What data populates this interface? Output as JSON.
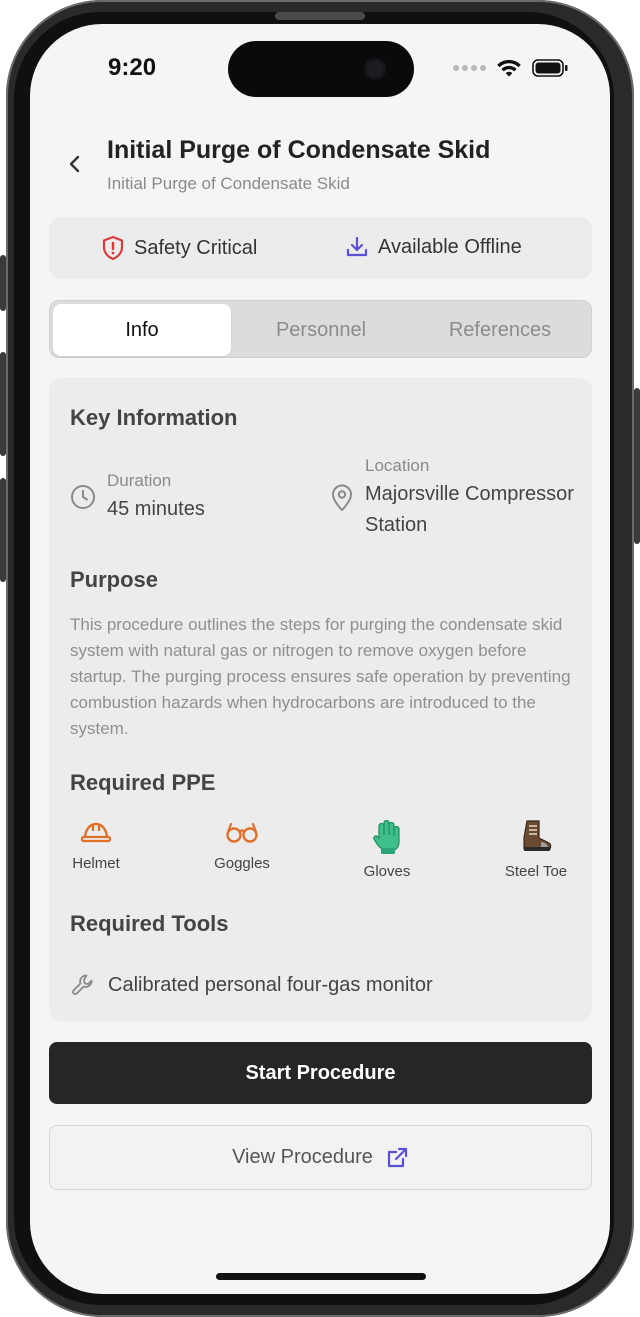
{
  "status_bar": {
    "time": "9:20"
  },
  "header": {
    "title": "Initial Purge of Condensate Skid",
    "subtitle": "Initial Purge of Condensate Skid"
  },
  "badges": {
    "safety": "Safety Critical",
    "offline": "Available Offline"
  },
  "tabs": [
    {
      "label": "Info",
      "active": true
    },
    {
      "label": "Personnel",
      "active": false
    },
    {
      "label": "References",
      "active": false
    }
  ],
  "key_info": {
    "title": "Key Information",
    "duration_label": "Duration",
    "duration_value": "45 minutes",
    "location_label": "Location",
    "location_line1": "Majorsville Compressor",
    "location_line2": "Station"
  },
  "purpose": {
    "title": "Purpose",
    "text": "This procedure outlines the steps for purging the condensate skid system with natural gas or nitrogen to remove oxygen before startup. The purging process ensures safe operation by preventing combustion hazards when hydrocarbons are introduced to the system."
  },
  "ppe": {
    "title": "Required PPE",
    "items": [
      {
        "label": "Helmet",
        "icon": "helmet-icon"
      },
      {
        "label": "Goggles",
        "icon": "goggles-icon"
      },
      {
        "label": "Gloves",
        "icon": "gloves-icon"
      },
      {
        "label": "Steel Toe",
        "icon": "boot-icon"
      }
    ]
  },
  "tools": {
    "title": "Required Tools",
    "items": [
      {
        "label": "Calibrated personal four-gas monitor",
        "icon": "wrench-icon"
      }
    ]
  },
  "actions": {
    "start": "Start Procedure",
    "view": "View Procedure"
  },
  "colors": {
    "safety_red": "#d93a3a",
    "offline_purple": "#5b4fd6",
    "ppe_orange": "#e0702a",
    "primary_dark": "#262626"
  }
}
